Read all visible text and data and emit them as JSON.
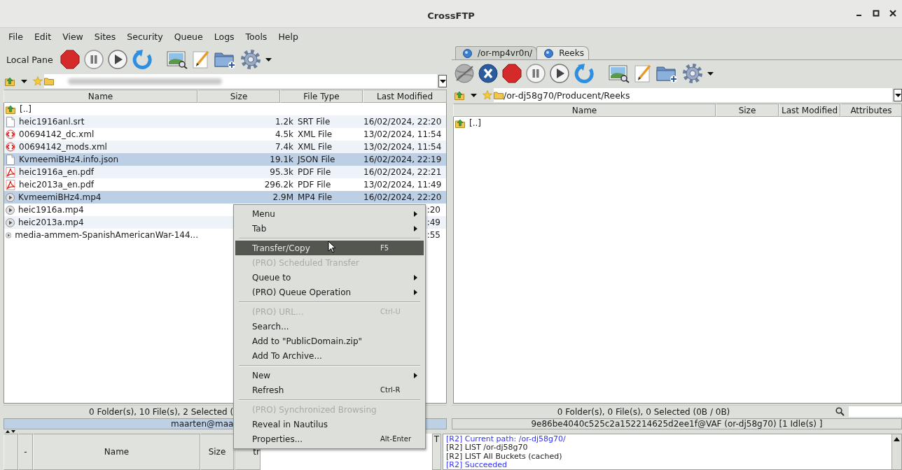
{
  "window": {
    "title": "CrossFTP"
  },
  "menu_bar": [
    "File",
    "Edit",
    "View",
    "Sites",
    "Security",
    "Queue",
    "Logs",
    "Tools",
    "Help"
  ],
  "left_pane": {
    "label": "Local Pane",
    "columns": [
      "Name",
      "Size",
      "File Type",
      "Last Modified"
    ],
    "rows": [
      {
        "kind": "parent",
        "name": "[..]",
        "selected": false
      },
      {
        "kind": "text",
        "name": "heic1916anl.srt",
        "size": "1.2k",
        "type": "SRT File",
        "modified": "16/02/2024, 22:20",
        "selected": false
      },
      {
        "kind": "xml",
        "name": "00694142_dc.xml",
        "size": "4.5k",
        "type": "XML File",
        "modified": "13/02/2024, 11:54",
        "selected": false
      },
      {
        "kind": "xml",
        "name": "00694142_mods.xml",
        "size": "7.4k",
        "type": "XML File",
        "modified": "13/02/2024, 11:54",
        "selected": false
      },
      {
        "kind": "text",
        "name": "KvmeemiBHz4.info.json",
        "size": "19.1k",
        "type": "JSON File",
        "modified": "16/02/2024, 22:19",
        "selected": true
      },
      {
        "kind": "pdf",
        "name": "heic1916a_en.pdf",
        "size": "95.3k",
        "type": "PDF File",
        "modified": "16/02/2024, 22:21",
        "selected": false
      },
      {
        "kind": "pdf",
        "name": "heic2013a_en.pdf",
        "size": "296.2k",
        "type": "PDF File",
        "modified": "13/02/2024, 11:49",
        "selected": false
      },
      {
        "kind": "video",
        "name": "KvmeemiBHz4.mp4",
        "size": "2.9M",
        "type": "MP4 File",
        "modified": "16/02/2024, 22:20",
        "selected": true
      },
      {
        "kind": "video",
        "name": "heic1916a.mp4",
        "modified": ":20",
        "selected": false
      },
      {
        "kind": "video",
        "name": "heic2013a.mp4",
        "modified": ":49",
        "selected": false
      },
      {
        "kind": "video",
        "name": "media-ammem-SpanishAmericanWar-144...",
        "modified": ":55",
        "selected": false
      }
    ],
    "status": "0 Folder(s), 10 File(s), 2 Selected (",
    "session": "maarten@maa"
  },
  "right_pane": {
    "tabs": [
      {
        "label": "/or-mp4vr0n/",
        "selected": false
      },
      {
        "label": "Reeks",
        "selected": true
      }
    ],
    "path": "/or-dj58g70/Producent/Reeks",
    "columns": [
      "Name",
      "Size",
      "Last Modified",
      "Attributes"
    ],
    "rows": [
      {
        "kind": "parent",
        "name": "[..]",
        "selected": false
      }
    ],
    "status": "0 Folder(s), 0 File(s), 0 Selected (0B / 0B)",
    "session": "9e86be4040c525c2a152214625d2ee1f@VAF (or-dj58g70) [1 Idle(s) ]"
  },
  "transfer_table": {
    "columns": [
      "-",
      "Name",
      "Size",
      "tr"
    ],
    "side_tab": "T"
  },
  "log": [
    {
      "text": "[R2] Current path: /or-dj58g70/",
      "color": "#3333ee"
    },
    {
      "text": "[R2] LIST /or-dj58g70",
      "color": "#222222"
    },
    {
      "text": "[R2] LIST All Buckets (cached)",
      "color": "#222222"
    },
    {
      "text": "[R2] Succeeded",
      "color": "#3333ee"
    }
  ],
  "context_menu": [
    {
      "kind": "item",
      "label": "Menu",
      "submenu": true,
      "disabled": false,
      "selected": false
    },
    {
      "kind": "item",
      "label": "Tab",
      "submenu": true,
      "disabled": false,
      "selected": false
    },
    {
      "kind": "separator"
    },
    {
      "kind": "item",
      "label": "Transfer/Copy",
      "shortcut": "F5",
      "submenu": false,
      "disabled": false,
      "selected": true
    },
    {
      "kind": "item",
      "label": "(PRO) Scheduled Transfer",
      "submenu": false,
      "disabled": true,
      "selected": false
    },
    {
      "kind": "item",
      "label": "Queue to",
      "submenu": true,
      "disabled": false,
      "selected": false
    },
    {
      "kind": "item",
      "label": "(PRO) Queue Operation",
      "submenu": true,
      "disabled": false,
      "selected": false
    },
    {
      "kind": "separator"
    },
    {
      "kind": "item",
      "label": "(PRO) URL...",
      "shortcut": "Ctrl-U",
      "submenu": false,
      "disabled": true,
      "selected": false
    },
    {
      "kind": "item",
      "label": "Search...",
      "submenu": false,
      "disabled": false,
      "selected": false
    },
    {
      "kind": "item",
      "label": "Add to \"PublicDomain.zip\"",
      "submenu": false,
      "disabled": false,
      "selected": false
    },
    {
      "kind": "item",
      "label": "Add To Archive...",
      "submenu": false,
      "disabled": false,
      "selected": false
    },
    {
      "kind": "separator"
    },
    {
      "kind": "item",
      "label": "New",
      "submenu": true,
      "disabled": false,
      "selected": false
    },
    {
      "kind": "item",
      "label": "Refresh",
      "shortcut": "Ctrl-R",
      "submenu": false,
      "disabled": false,
      "selected": false
    },
    {
      "kind": "separator"
    },
    {
      "kind": "item",
      "label": "(PRO) Synchronized Browsing",
      "submenu": false,
      "disabled": true,
      "selected": false
    },
    {
      "kind": "item",
      "label": "Reveal in Nautilus",
      "submenu": false,
      "disabled": false,
      "selected": false
    },
    {
      "kind": "item",
      "label": "Properties...",
      "shortcut": "Alt-Enter",
      "submenu": false,
      "disabled": false,
      "selected": false
    }
  ]
}
